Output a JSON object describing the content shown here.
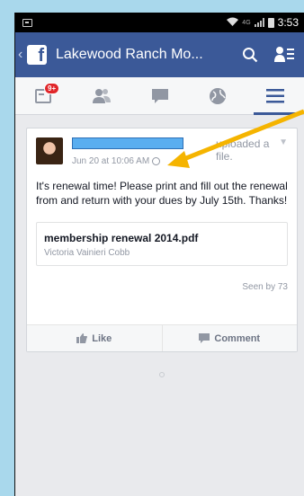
{
  "status_bar": {
    "network": "4G",
    "time": "3:53"
  },
  "app_bar": {
    "back": "‹",
    "logo": "f",
    "title": "Lakewood Ranch Mo..."
  },
  "tabs": [
    {
      "name": "notifications",
      "badge": "9+"
    },
    {
      "name": "friends"
    },
    {
      "name": "messages"
    },
    {
      "name": "globe"
    },
    {
      "name": "menu",
      "active": true
    }
  ],
  "post": {
    "action_text": "uploaded a file.",
    "timestamp": "Jun 20 at 10:06 AM",
    "body": "It's renewal time! Please print and fill out the renewal from and return with your dues by July 15th. Thanks!",
    "attachment": {
      "title": "membership renewal 2014.pdf",
      "author": "Victoria Vainieri Cobb"
    },
    "seen_by": "Seen by 73",
    "like_label": "Like",
    "comment_label": "Comment"
  },
  "colors": {
    "facebook_blue": "#3b5998",
    "annotation_arrow": "#f5b400",
    "badge_red": "#e0262a"
  }
}
